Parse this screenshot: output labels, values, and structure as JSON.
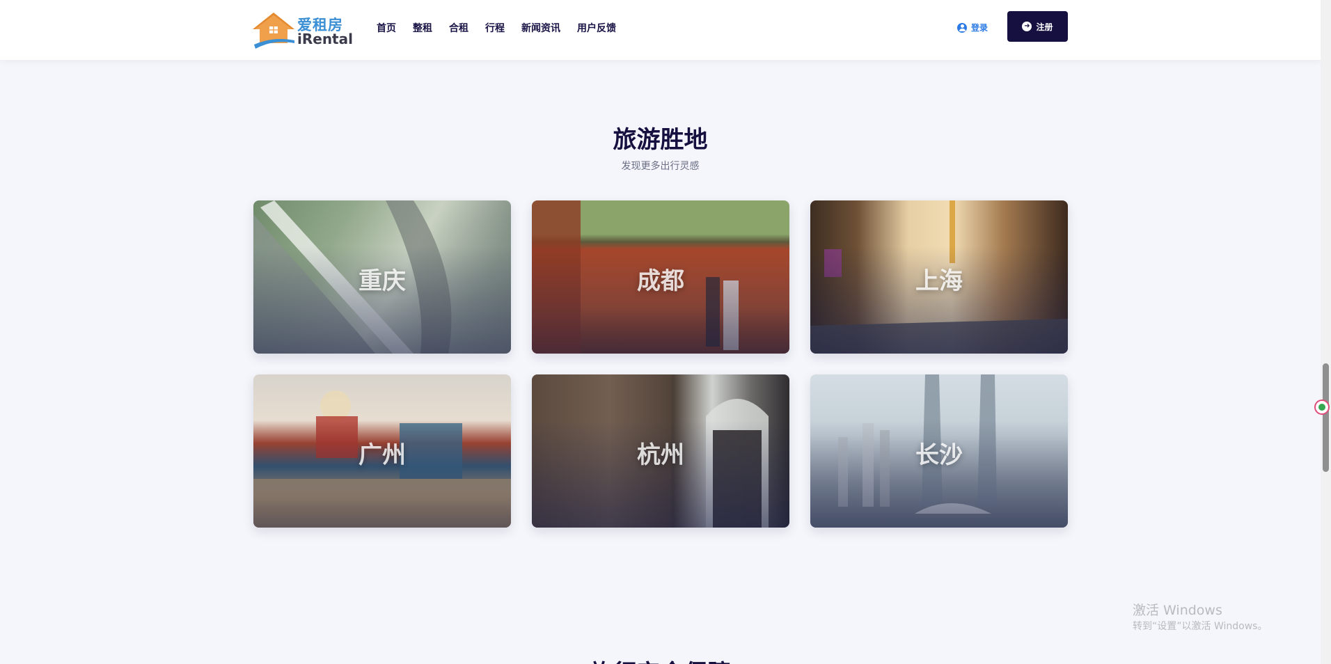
{
  "header": {
    "logo": {
      "cn": "爱租房",
      "en": "iRental"
    },
    "nav": [
      "首页",
      "整租",
      "合租",
      "行程",
      "新闻资讯",
      "用户反馈"
    ],
    "login_label": "登录",
    "register_label": "注册"
  },
  "section": {
    "title": "旅游胜地",
    "subtitle": "发现更多出行灵感",
    "cities": [
      {
        "name": "重庆"
      },
      {
        "name": "成都"
      },
      {
        "name": "上海"
      },
      {
        "name": "广州"
      },
      {
        "name": "杭州"
      },
      {
        "name": "长沙"
      }
    ]
  },
  "next_section_title": "旅行安全保障",
  "watermark": {
    "line1": "激活 Windows",
    "line2": "转到“设置”以激活 Windows。"
  },
  "colors": {
    "brand_dark": "#15103f",
    "link_blue": "#2c7be5",
    "logo_orange": "#f0a04b",
    "page_bg": "#f5f6fb"
  },
  "icons": [
    "house-logo-icon",
    "user-circle-icon",
    "arrow-circle-right-icon"
  ]
}
